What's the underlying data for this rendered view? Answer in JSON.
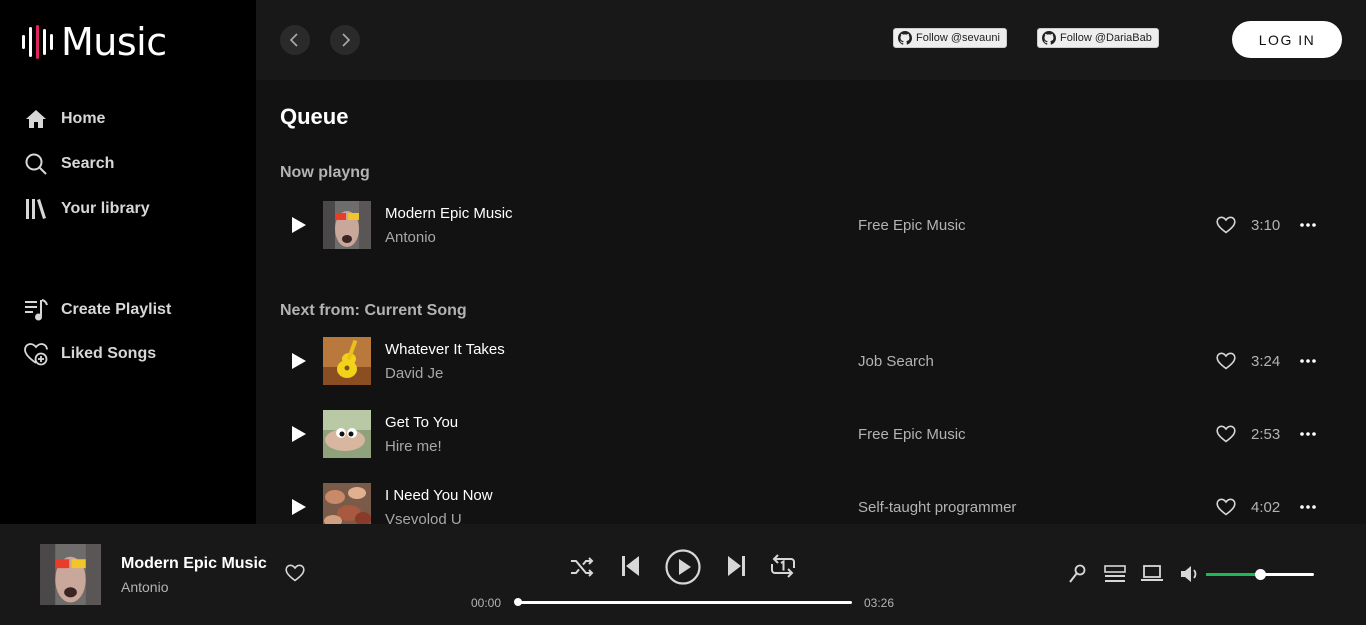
{
  "app": {
    "logo_text": "Music"
  },
  "sidebar": {
    "nav": [
      {
        "label": "Home",
        "icon": "home-icon"
      },
      {
        "label": "Search",
        "icon": "search-icon"
      },
      {
        "label": "Your library",
        "icon": "library-icon"
      }
    ],
    "actions": [
      {
        "label": "Create Playlist",
        "icon": "playlist-add-icon"
      },
      {
        "label": "Liked Songs",
        "icon": "heart-plus-icon"
      }
    ]
  },
  "topbar": {
    "github_badges": [
      "Follow @sevauni",
      "Follow @DariaBab"
    ],
    "login_label": "LOG IN"
  },
  "queue": {
    "title": "Queue",
    "now_playing_label": "Now playng",
    "now_playing": {
      "name": "Modern Epic Music",
      "artist": "Antonio",
      "album": "Free Epic Music",
      "duration": "3:10",
      "cover": "glasses"
    },
    "next_label": "Next from: Current Song",
    "next": [
      {
        "name": "Whatever It Takes",
        "artist": "David Je",
        "album": "Job Search",
        "duration": "3:24",
        "cover": "ukulele"
      },
      {
        "name": "Get To You",
        "artist": "Hire me!",
        "album": "Free Epic Music",
        "duration": "2:53",
        "cover": "eyes"
      },
      {
        "name": "I Need You Now",
        "artist": "Vsevolod U",
        "album": "Self-taught programmer",
        "duration": "4:02",
        "cover": "leaves"
      }
    ]
  },
  "player": {
    "title": "Modern Epic Music",
    "artist": "Antonio",
    "time_current": "00:00",
    "time_total": "03:26",
    "progress": 0,
    "volume": 0.5
  },
  "colors": {
    "accent": "#1db954",
    "background": "#121212",
    "sidebar": "#000000",
    "panel": "#181818"
  }
}
